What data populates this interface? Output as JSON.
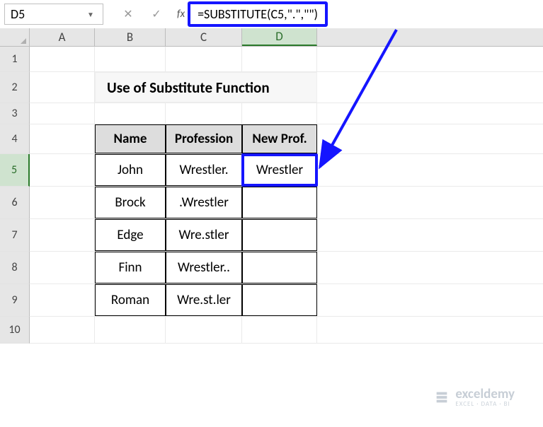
{
  "namebox": {
    "value": "D5"
  },
  "formula_bar": {
    "value": "=SUBSTITUTE(C5,\".\",\"\")"
  },
  "columns": [
    "A",
    "B",
    "C",
    "D"
  ],
  "active_column": "D",
  "rows": [
    "1",
    "2",
    "3",
    "4",
    "5",
    "6",
    "7",
    "8",
    "9",
    "10"
  ],
  "active_row": "5",
  "title": "Use of Substitute Function",
  "table": {
    "headers": [
      "Name",
      "Profession",
      "New Prof."
    ],
    "data": [
      {
        "name": "John",
        "prof": "Wrestler.",
        "newprof": "Wrestler"
      },
      {
        "name": "Brock",
        "prof": ".Wrestler",
        "newprof": ""
      },
      {
        "name": "Edge",
        "prof": "Wre.stler",
        "newprof": ""
      },
      {
        "name": "Finn",
        "prof": "Wrestler..",
        "newprof": ""
      },
      {
        "name": "Roman",
        "prof": "Wre.st.ler",
        "newprof": ""
      }
    ]
  },
  "watermark": {
    "top": "exceldemy",
    "bottom": "EXCEL · DATA · BI"
  },
  "chart_data": {
    "type": "table",
    "title": "Use of Substitute Function",
    "formula": "=SUBSTITUTE(C5,\".\",\"\")",
    "columns": [
      "Name",
      "Profession",
      "New Prof."
    ],
    "rows": [
      [
        "John",
        "Wrestler.",
        "Wrestler"
      ],
      [
        "Brock",
        ".Wrestler",
        ""
      ],
      [
        "Edge",
        "Wre.stler",
        ""
      ],
      [
        "Finn",
        "Wrestler..",
        ""
      ],
      [
        "Roman",
        "Wre.st.ler",
        ""
      ]
    ]
  }
}
